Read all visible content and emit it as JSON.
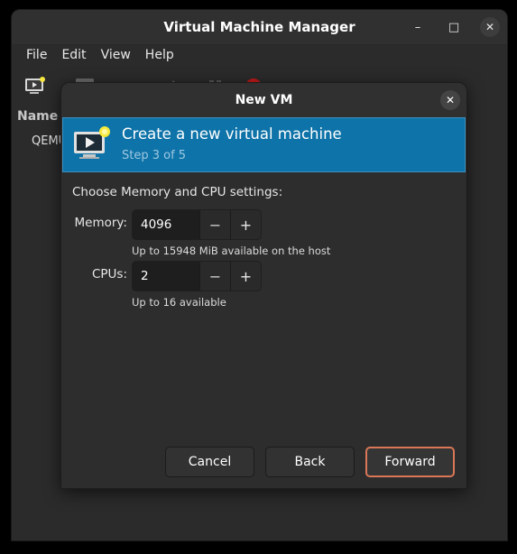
{
  "main_window": {
    "title": "Virtual Machine Manager",
    "controls": {
      "minimize": "–",
      "maximize": "□",
      "close": "✕"
    },
    "menu": [
      "File",
      "Edit",
      "View",
      "Help"
    ],
    "list_header": "Name",
    "list_row": "QEMU"
  },
  "dialog": {
    "title": "New VM",
    "close_glyph": "✕",
    "banner": {
      "title": "Create a new virtual machine",
      "step": "Step 3 of 5"
    },
    "section_label": "Choose Memory and CPU settings:",
    "memory": {
      "label": "Memory:",
      "value": "4096",
      "hint": "Up to 15948 MiB available on the host"
    },
    "cpus": {
      "label": "CPUs:",
      "value": "2",
      "hint": "Up to 16 available"
    },
    "spin_minus": "−",
    "spin_plus": "+",
    "buttons": {
      "cancel": "Cancel",
      "back": "Back",
      "forward": "Forward"
    }
  },
  "colors": {
    "banner_bg": "#0e73a8",
    "forward_border": "#d97757",
    "window_bg": "#2b2b2b"
  }
}
